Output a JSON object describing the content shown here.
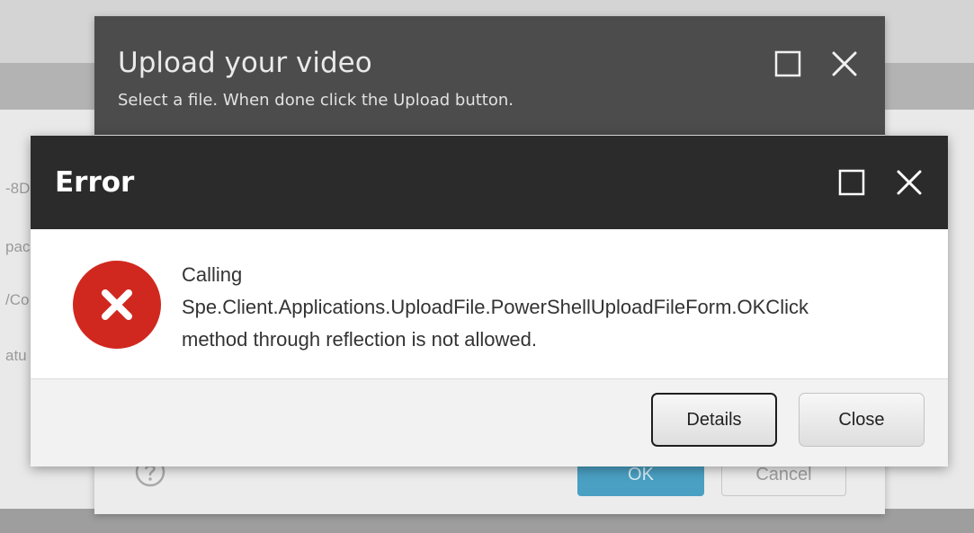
{
  "background": {
    "fragments": [
      "-8D",
      "pace",
      "/Co",
      "atu"
    ]
  },
  "upload_dialog": {
    "title": "Upload your video",
    "subtitle": "Select a file. When done click the Upload button.",
    "ok_label": "OK",
    "cancel_label": "Cancel",
    "help_icon": "question-icon",
    "maximize_icon": "maximize-icon",
    "close_icon": "close-icon"
  },
  "error_dialog": {
    "title": "Error",
    "message_lines": [
      "Calling",
      "Spe.Client.Applications.UploadFile.PowerShellUploadFileForm.OKClick",
      "method through reflection is not allowed."
    ],
    "details_label": "Details",
    "close_label": "Close",
    "status_icon": "error-x-icon",
    "maximize_icon": "maximize-icon",
    "close_icon": "close-icon"
  },
  "colors": {
    "error_header": "#2b2b2b",
    "upload_header": "#4c4c4c",
    "error_icon": "#d0281f",
    "ok_button": "#4aa0c3"
  }
}
